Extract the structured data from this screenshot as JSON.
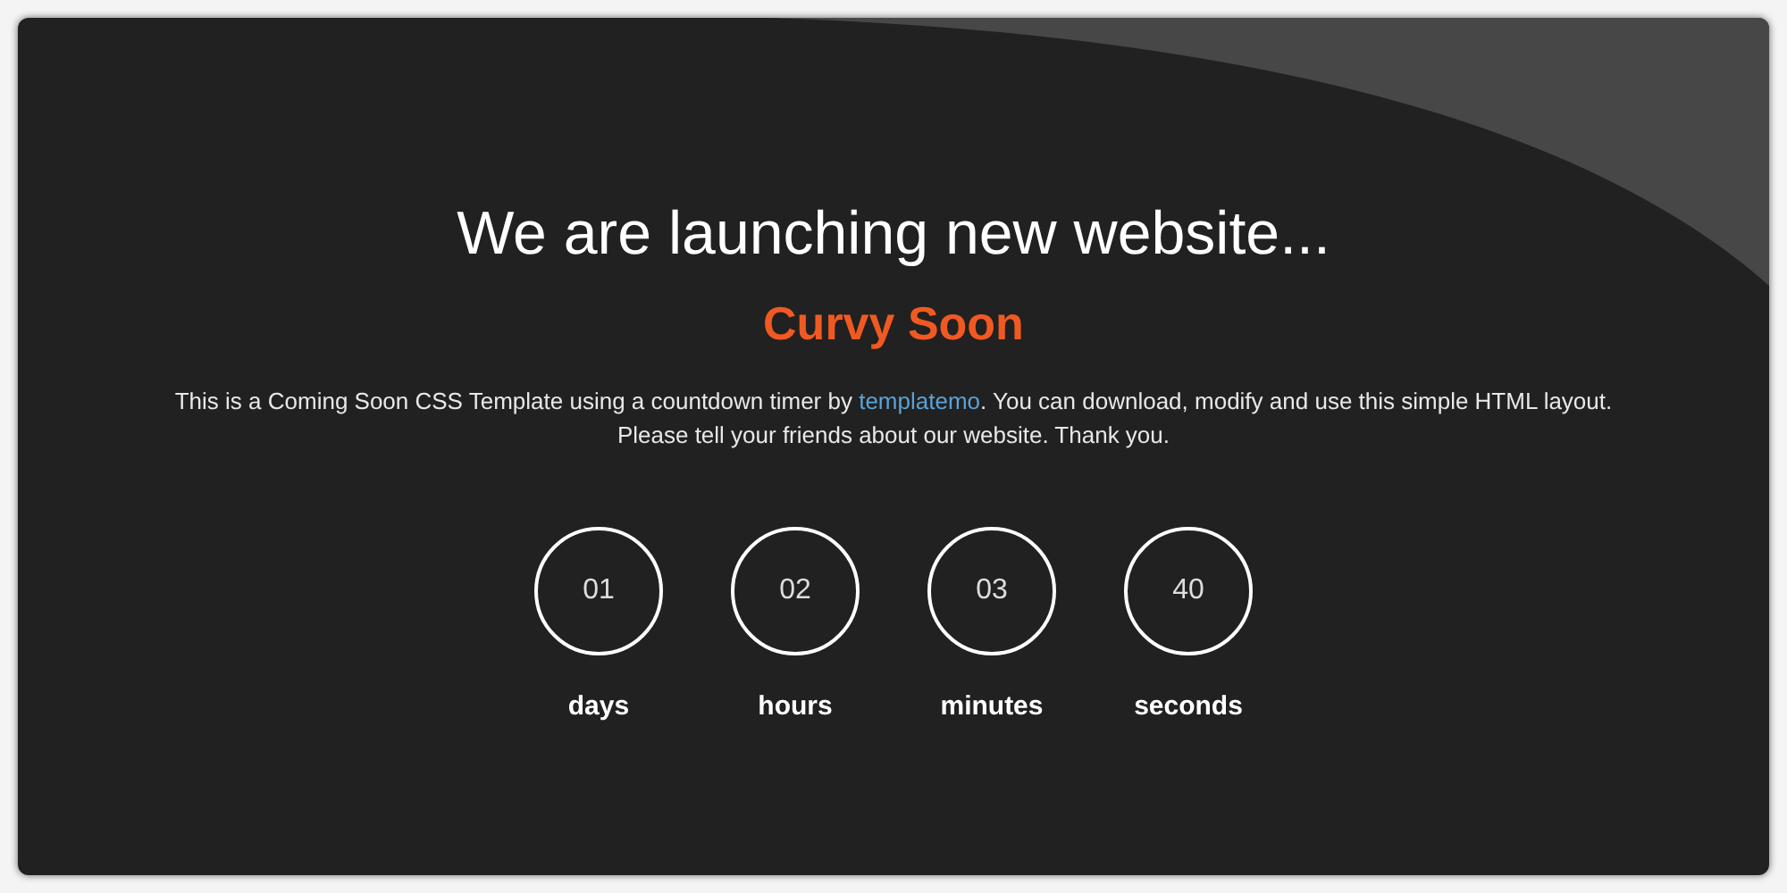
{
  "heading": "We are launching new website...",
  "brand": "Curvy Soon",
  "description": {
    "before": "This is a Coming Soon CSS Template using a countdown timer by ",
    "link": "templatemo",
    "after": ". You can download, modify and use this simple HTML layout.",
    "line_2": "Please tell your friends about our website. Thank you."
  },
  "countdown": [
    {
      "value": "01",
      "label": "days"
    },
    {
      "value": "02",
      "label": "hours"
    },
    {
      "value": "03",
      "label": "minutes"
    },
    {
      "value": "40",
      "label": "seconds"
    }
  ]
}
